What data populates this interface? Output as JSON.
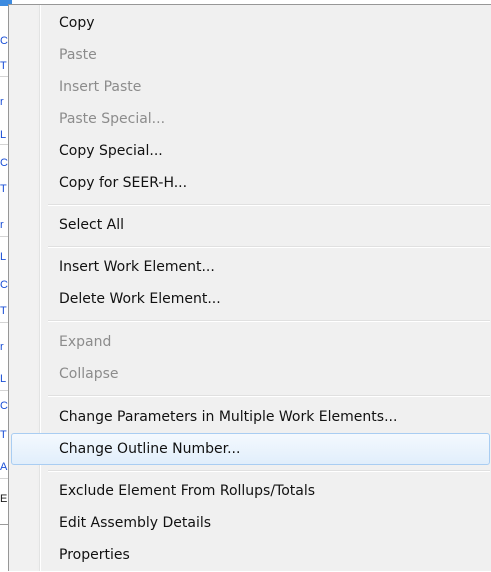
{
  "background": {
    "fragments": [
      "C",
      "T",
      "r",
      "L",
      "C",
      "T",
      "r",
      "L",
      "C",
      "T",
      "r",
      "L",
      "C",
      "T",
      "A",
      "E"
    ]
  },
  "menu": {
    "items": [
      {
        "label": "Copy",
        "enabled": true
      },
      {
        "label": "Paste",
        "enabled": false
      },
      {
        "label": "Insert Paste",
        "enabled": false
      },
      {
        "label": "Paste Special...",
        "enabled": false
      },
      {
        "label": "Copy Special...",
        "enabled": true
      },
      {
        "label": "Copy for SEER-H...",
        "enabled": true
      },
      {
        "label": "Select All",
        "enabled": true
      },
      {
        "label": "Insert Work Element...",
        "enabled": true
      },
      {
        "label": "Delete Work Element...",
        "enabled": true
      },
      {
        "label": "Expand",
        "enabled": false
      },
      {
        "label": "Collapse",
        "enabled": false
      },
      {
        "label": "Change Parameters in Multiple Work Elements...",
        "enabled": true
      },
      {
        "label": "Change Outline Number...",
        "enabled": true,
        "highlighted": true
      },
      {
        "label": "Exclude Element From Rollups/Totals",
        "enabled": true
      },
      {
        "label": "Edit Assembly Details",
        "enabled": true
      },
      {
        "label": "Properties",
        "enabled": true
      }
    ]
  },
  "colors": {
    "menu_bg": "#f0f0f0",
    "highlight_border": "#a9cdf2",
    "disabled_text": "#8c8c8c",
    "bg_link_text": "#1a4fd6"
  }
}
